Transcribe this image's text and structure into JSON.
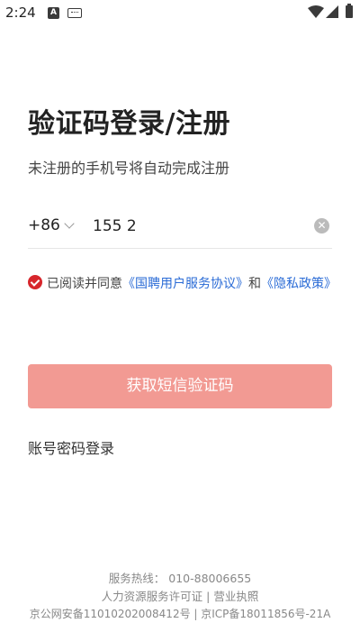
{
  "status_bar": {
    "time": "2:24",
    "icons": [
      "a-notification-icon",
      "keyboard-icon",
      "wifi-icon",
      "signal-icon",
      "battery-icon"
    ]
  },
  "title": "验证码登录/注册",
  "subtitle": "未注册的手机号将自动完成注册",
  "phone": {
    "country_code": "+86",
    "value": "155 2",
    "clear_icon": "clear-icon"
  },
  "agreement": {
    "checked": true,
    "prefix": "已阅读并同意",
    "terms_link": "《国聘用户服务协议》",
    "conjunction": "和",
    "privacy_link": "《隐私政策》"
  },
  "buttons": {
    "get_code": "获取短信验证码",
    "password_login": "账号密码登录"
  },
  "footer": {
    "hotline_label": "服务热线：",
    "hotline": "010-88006655",
    "license": "人力资源服务许可证",
    "separator": "|",
    "business_license": "营业执照",
    "icp": "京公网安备11010202008412号 | 京ICP备18011856号-21A"
  },
  "colors": {
    "accent": "#d7262c",
    "button_disabled": "#f29a93",
    "link": "#2a6bd6"
  }
}
